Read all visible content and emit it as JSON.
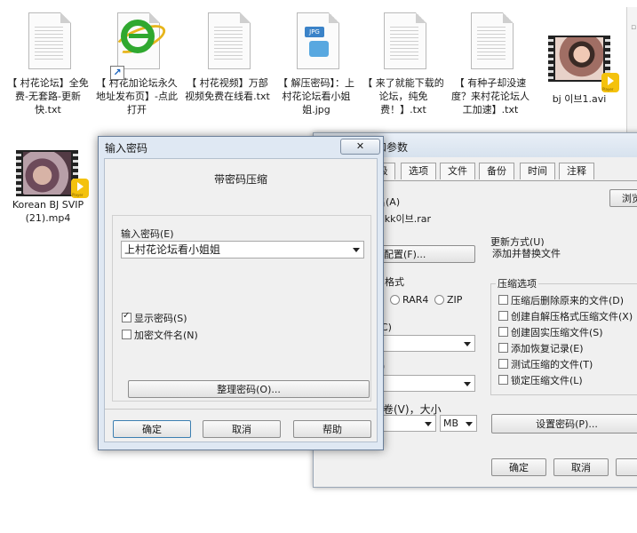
{
  "desktop_files": [
    {
      "label": "【 村花论坛】全免费-无套路-更新快.txt",
      "type": "txt"
    },
    {
      "label": "【 村花加论坛永久地址发布页】-点此打开",
      "type": "ie-shortcut"
    },
    {
      "label": "【 村花视频】万部视频免费在线看.txt",
      "type": "txt"
    },
    {
      "label": "【 解压密码】：上村花论坛看小姐姐.jpg",
      "type": "jpg"
    },
    {
      "label": "【 来了就能下载的论坛，纯免费！】.txt",
      "type": "txt"
    },
    {
      "label": "【 有种子却没速度？来村花论坛人工加速】.txt",
      "type": "txt"
    },
    {
      "label": "bj 이브1.avi",
      "type": "video"
    },
    {
      "label": "Korean BJ SVIP (21).mp4",
      "type": "video"
    }
  ],
  "jpg_badge": "JPG",
  "bg_window": {
    "title": "和参数",
    "tabs": [
      "级",
      "选项",
      "文件",
      "备份",
      "时间",
      "注释"
    ],
    "archive_name_label": "名(A)",
    "browse_button": "浏览",
    "archive_name_value": "alkk이브.rar",
    "profile_button": "配置(F)...",
    "update_mode_label": "更新方式(U)",
    "update_mode_value": "添加并替换文件",
    "format_label": "格式",
    "format_options": [
      "RAR4",
      "ZIP"
    ],
    "compress_options_title": "压缩选项",
    "compress_options": [
      "压缩后删除原来的文件(D)",
      "创建自解压格式压缩文件(X)",
      "创建固实压缩文件(S)",
      "添加恢复记录(E)",
      "测试压缩的文件(T)",
      "锁定压缩文件(L)"
    ],
    "split_label": "卷(V)，大小",
    "unit_value": "MB",
    "set_password_button": "设置密码(P)...",
    "ok_button": "确定",
    "cancel_button": "取消",
    "stray_label_c": "C)",
    "stray_label_paren": ")"
  },
  "password_dialog": {
    "title": "输入密码",
    "close_glyph": "✕",
    "heading": "带密码压缩",
    "password_label": "输入密码(E)",
    "password_value": "上村花论坛看小姐姐",
    "show_password_label": "显示密码(S)",
    "show_password_checked": true,
    "encrypt_filenames_label": "加密文件名(N)",
    "encrypt_filenames_checked": false,
    "organize_button": "整理密码(O)...",
    "ok_button": "确定",
    "cancel_button": "取消",
    "help_button": "帮助"
  },
  "colors": {
    "ie_green": "#2fa82f",
    "ie_ring": "#e7b51c",
    "title_bar": "#dfe8f3"
  }
}
